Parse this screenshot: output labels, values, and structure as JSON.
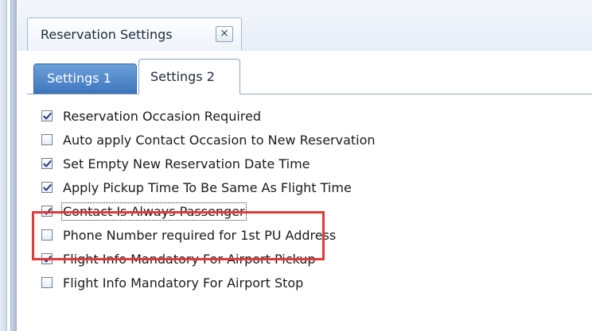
{
  "document_tab": {
    "title": "Reservation Settings",
    "close_glyph": "×"
  },
  "settings_tabs": [
    {
      "label": "Settings 1",
      "active": false
    },
    {
      "label": "Settings 2",
      "active": true
    }
  ],
  "options": [
    {
      "label": "Reservation Occasion Required",
      "checked": true
    },
    {
      "label": "Auto apply Contact Occasion to New Reservation",
      "checked": false
    },
    {
      "label": "Set Empty New Reservation Date Time",
      "checked": true
    },
    {
      "label": "Apply Pickup Time To Be Same As Flight Time",
      "checked": true
    },
    {
      "label": "Contact Is Always Passenger",
      "checked": true,
      "focused": true
    },
    {
      "label": "Phone Number required for 1st PU Address",
      "checked": false
    },
    {
      "label": "Flight Info Mandatory For Airport Pickup",
      "checked": true
    },
    {
      "label": "Flight Info Mandatory For Airport Stop",
      "checked": false
    }
  ],
  "colors": {
    "highlight": "#e03a3a",
    "check": "#1f3f73"
  }
}
